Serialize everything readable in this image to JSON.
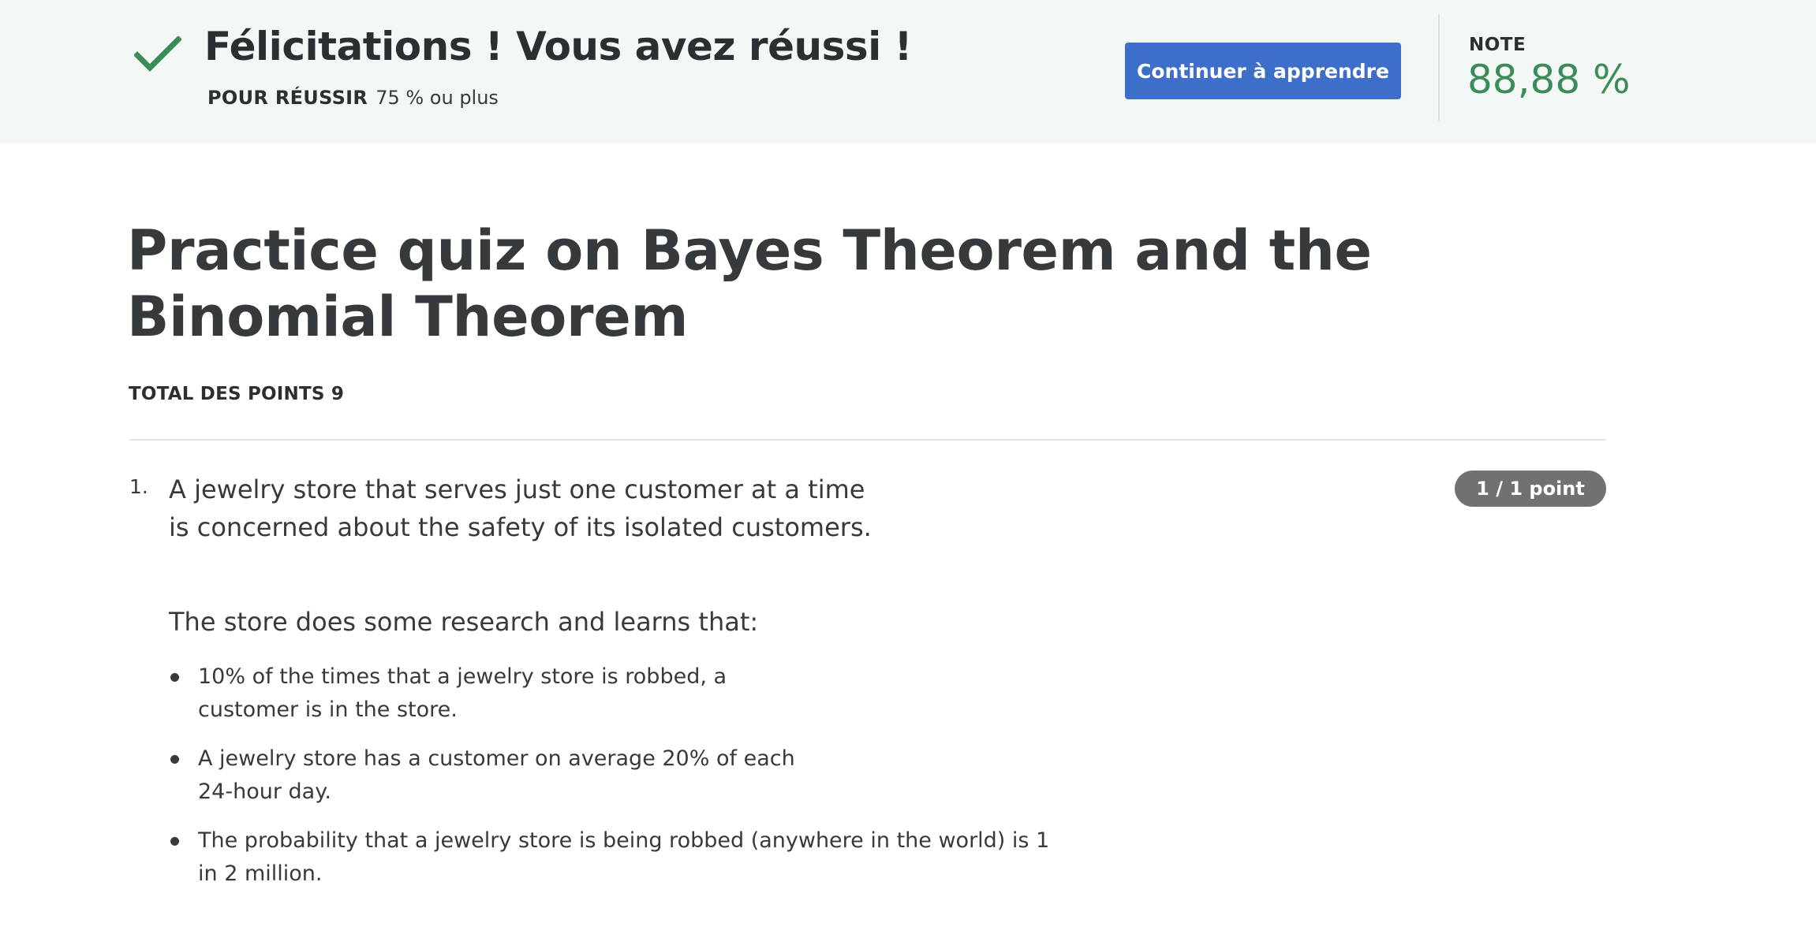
{
  "banner": {
    "title": "Félicitations ! Vous avez réussi !",
    "pass_label": "POUR RÉUSSIR",
    "pass_value": "75 % ou plus",
    "continue_label": "Continuer à apprendre",
    "grade_label": "NOTE",
    "grade_value": "88,88 %",
    "check_icon": "check-icon",
    "colors": {
      "background": "#f3f8f6",
      "accent_green": "#3c8c5a",
      "button_blue": "#3d6fca"
    }
  },
  "quiz": {
    "title": "Practice quiz on Bayes Theorem and the Binomial Theorem",
    "total_points": "TOTAL DES POINTS 9"
  },
  "questions": [
    {
      "number": "1.",
      "points_badge": "1 / 1 point",
      "text": "A jewelry store that serves just one customer at a time is concerned about the safety of its isolated customers.",
      "intro": "The store does some research and learns that:",
      "bullets": [
        "10% of the times that a jewelry store is robbed, a customer is in the store.",
        "A jewelry store has a customer on average 20% of each 24-hour day.",
        "The probability that a jewelry store is being robbed (anywhere in the world) is 1 in 2 million."
      ]
    }
  ]
}
